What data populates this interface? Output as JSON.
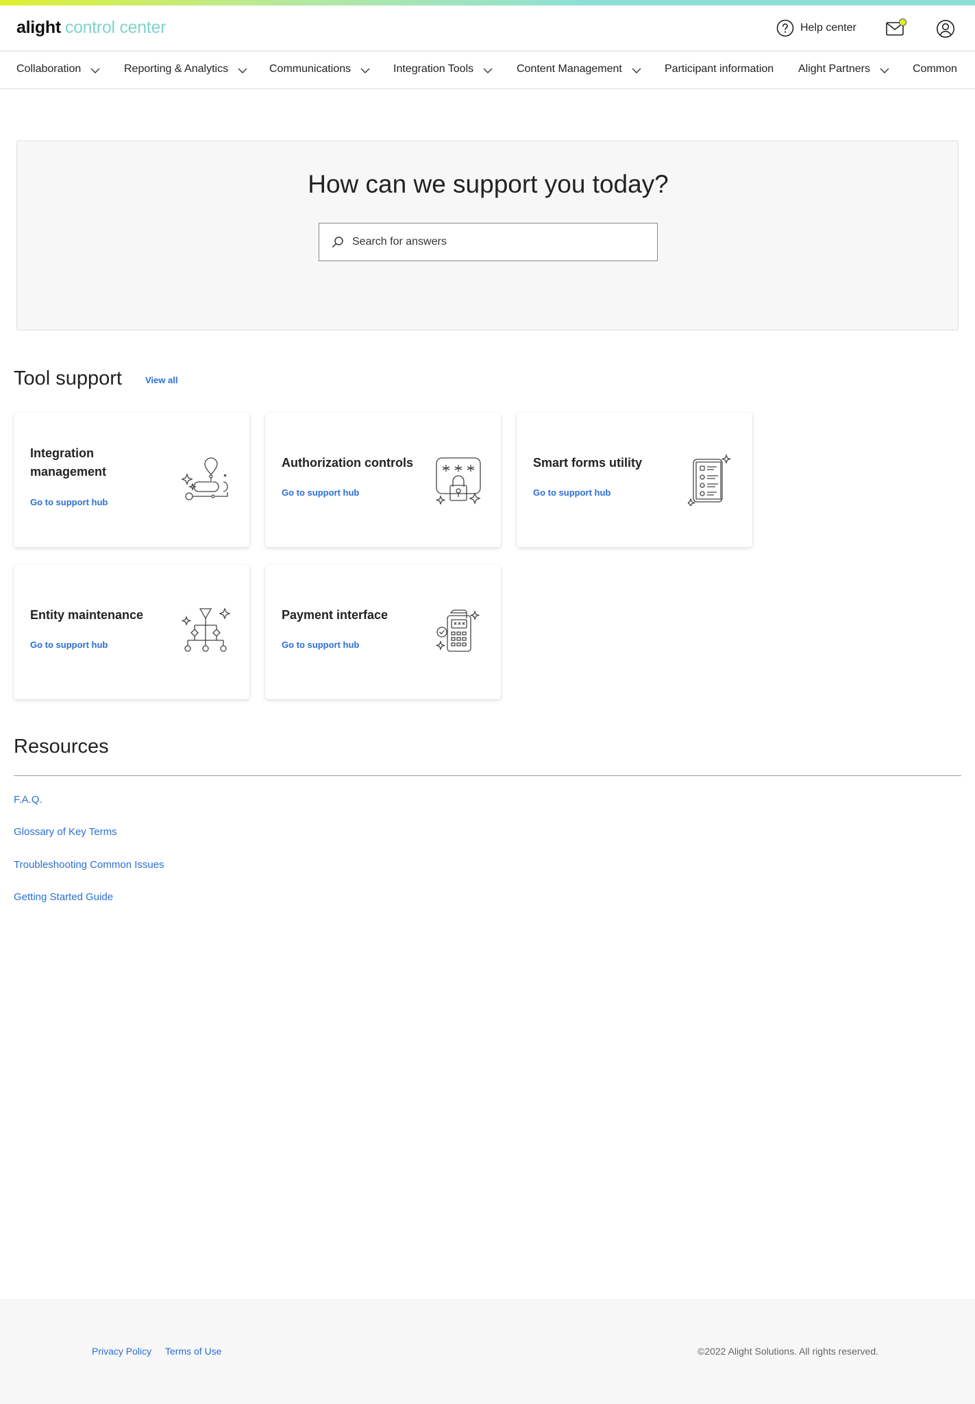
{
  "header": {
    "logo_brand": "alight",
    "logo_product": "control center",
    "help_label": "Help center",
    "icons": [
      "help-icon",
      "mail-icon",
      "user-icon"
    ]
  },
  "nav": {
    "items": [
      {
        "label": "Collaboration",
        "has_dropdown": true
      },
      {
        "label": "Reporting & Analytics",
        "has_dropdown": true
      },
      {
        "label": "Communications",
        "has_dropdown": true
      },
      {
        "label": "Integration Tools",
        "has_dropdown": true
      },
      {
        "label": "Content Management",
        "has_dropdown": true
      },
      {
        "label": "Participant information",
        "has_dropdown": false
      },
      {
        "label": "Alight Partners",
        "has_dropdown": true
      },
      {
        "label": "Common",
        "has_dropdown": false
      }
    ]
  },
  "hero": {
    "title": "How can we support you today?",
    "search_placeholder": "Search for answers"
  },
  "tool_support": {
    "title": "Tool support",
    "view_all": "View all",
    "cards": [
      {
        "title": "Integration management",
        "link": "Go to support hub",
        "icon": "integration-icon"
      },
      {
        "title": "Authorization controls",
        "link": "Go to support hub",
        "icon": "authorization-icon"
      },
      {
        "title": "Smart forms utility",
        "link": "Go to support hub",
        "icon": "smart-forms-icon"
      },
      {
        "title": "Entity maintenance",
        "link": "Go to support hub",
        "icon": "entity-icon"
      },
      {
        "title": "Payment interface",
        "link": "Go to support hub",
        "icon": "payment-icon"
      }
    ]
  },
  "resources": {
    "title": "Resources",
    "links": [
      "F.A.Q.",
      "Glossary of Key Terms",
      "Troubleshooting Common Issues",
      "Getting Started Guide"
    ]
  },
  "footer": {
    "privacy": "Privacy Policy",
    "terms": "Terms of Use",
    "copyright": "©2022 Alight Solutions. All rights reserved."
  },
  "colors": {
    "accent_link": "#2a6fd6",
    "logo_product": "#7fd3cc",
    "notification_dot": "#e3ee2d"
  }
}
